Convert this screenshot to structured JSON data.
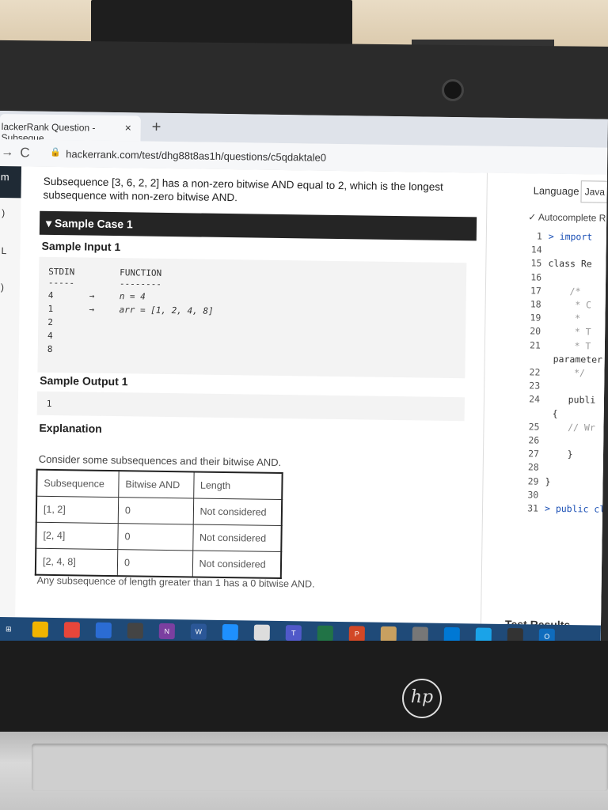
{
  "browser": {
    "tab_title": "lackerRank Question - Subseque",
    "tab_close": "×",
    "new_tab": "+",
    "nav_forward": "→",
    "nav_reload": "C",
    "url": "hackerrank.com/test/dhg88t8as1h/questions/c5qdaktale0"
  },
  "sidebar": {
    "brand": "m",
    "glyphs": [
      ")",
      "L",
      ")"
    ]
  },
  "problem": {
    "intro": "Subsequence [3, 6, 2, 2] has a non-zero bitwise AND equal to 2, which is the longest subsequence with non-zero bitwise AND.",
    "sample_case_header": "▾ Sample Case 1",
    "sample_input_label": "Sample Input 1",
    "stdin_header": "STDIN",
    "stdin_rule": "-----",
    "function_header": "FUNCTION",
    "function_rule": "--------",
    "stdin_values": [
      "4",
      "1",
      "2",
      "4",
      "8"
    ],
    "arrows": [
      "→",
      "→"
    ],
    "function_lines": [
      "n = 4",
      "arr = [1, 2, 4, 8]"
    ],
    "sample_output_label": "Sample Output 1",
    "sample_output_value": "1",
    "explanation_label": "Explanation",
    "explanation_text": "Consider some subsequences and their bitwise AND.",
    "table": {
      "headers": [
        "Subsequence",
        "Bitwise AND",
        "Length"
      ],
      "rows": [
        [
          "[1, 2]",
          "0",
          "Not considered"
        ],
        [
          "[2, 4]",
          "0",
          "Not considered"
        ],
        [
          "[2, 4, 8]",
          "0",
          "Not considered"
        ]
      ]
    },
    "note": "Any subsequence of length greater than 1 has a 0 bitwise AND."
  },
  "editor": {
    "language_label": "Language",
    "language_value": "Java",
    "autocomplete_label": "Autocomplete R",
    "lines": [
      {
        "n": "1",
        "t": "> import"
      },
      {
        "n": "14",
        "t": ""
      },
      {
        "n": "15",
        "t": "class Re"
      },
      {
        "n": "16",
        "t": ""
      },
      {
        "n": "17",
        "t": "    /*"
      },
      {
        "n": "18",
        "t": "     * C"
      },
      {
        "n": "19",
        "t": "     *"
      },
      {
        "n": "20",
        "t": "     * T"
      },
      {
        "n": "21",
        "t": "     * T"
      },
      {
        "n": "",
        "t": "parameter"
      },
      {
        "n": "22",
        "t": "     */"
      },
      {
        "n": "23",
        "t": ""
      },
      {
        "n": "24",
        "t": "    publi"
      },
      {
        "n": "",
        "t": "{"
      },
      {
        "n": "25",
        "t": "    // Wr"
      },
      {
        "n": "26",
        "t": ""
      },
      {
        "n": "27",
        "t": "    }"
      },
      {
        "n": "28",
        "t": ""
      },
      {
        "n": "29",
        "t": "}"
      },
      {
        "n": "30",
        "t": ""
      },
      {
        "n": "31",
        "t": "> public cla"
      }
    ],
    "test_results": "Test Results"
  },
  "taskbar": {
    "items": [
      "⊞",
      "",
      "",
      "",
      "",
      "N",
      "W",
      "",
      "",
      "T",
      "",
      "P",
      "",
      "",
      "",
      "",
      "",
      "O"
    ],
    "colors": [
      "#1f4a78",
      "#f0b400",
      "#e8463a",
      "#2b6cd4",
      "#444",
      "#7b3fa0",
      "#2b5797",
      "#1e90ff",
      "#ddd",
      "#5059c9",
      "#217346",
      "#d24726",
      "#c8a060",
      "#777",
      "#0078d4",
      "#1aa3e8",
      "#333",
      "#0f6cbd"
    ]
  },
  "hardware": {
    "logo": "hp"
  }
}
